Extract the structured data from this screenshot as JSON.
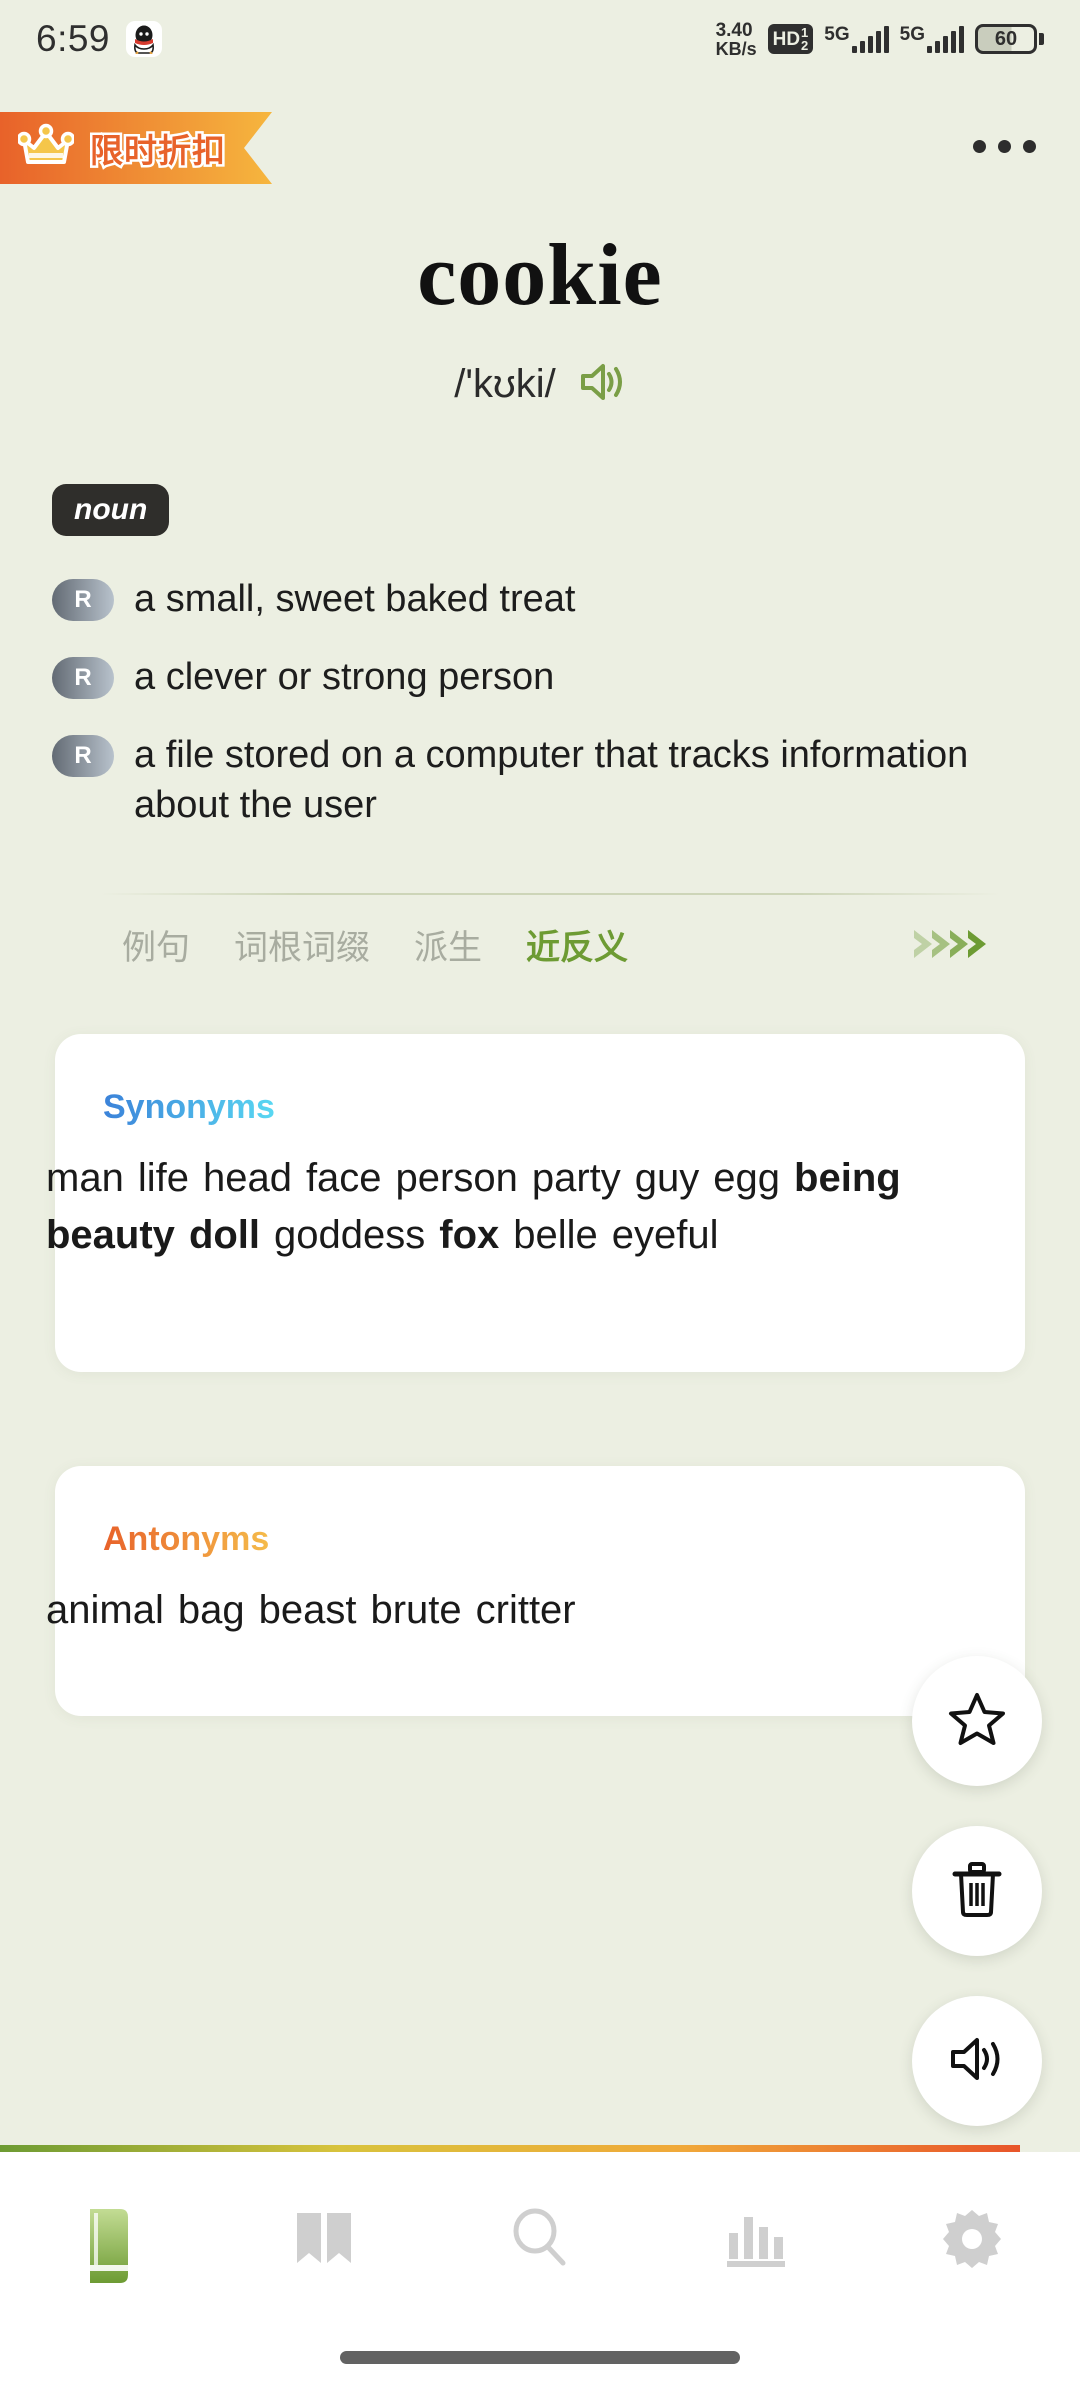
{
  "status_bar": {
    "clock": "6:59",
    "qq_icon": "qq-penguin-icon",
    "net_speed_value": "3.40",
    "net_speed_unit": "KB/s",
    "hd_label": "HD",
    "hd_sim_top": "1",
    "hd_sim_bottom": "2",
    "sim1_network": "5G",
    "sim2_network": "5G",
    "battery_level": "60"
  },
  "promo": {
    "label": "限时折扣",
    "crown_icon": "crown-icon",
    "gradient_start": "#e8622a",
    "gradient_end": "#f6b63e"
  },
  "overflow_menu_icon": "more-horizontal-icon",
  "word": {
    "headword": "cookie",
    "phonetic": "/'kʊki/",
    "speaker_icon": "speaker-icon",
    "speaker_color": "#7a9e46",
    "part_of_speech": "noun",
    "definitions": [
      {
        "badge": "R",
        "text": "a small, sweet baked treat"
      },
      {
        "badge": "R",
        "text": "a clever or strong person"
      },
      {
        "badge": "R",
        "text": "a file stored on a computer that tracks information about the user"
      }
    ]
  },
  "tabs": {
    "items": [
      {
        "label": "例句",
        "active": false
      },
      {
        "label": "词根词缀",
        "active": false
      },
      {
        "label": "派生",
        "active": false
      },
      {
        "label": "近反义",
        "active": true
      }
    ],
    "more_icon": "double-chevron-right-icon",
    "active_color": "#6d9b33",
    "inactive_color": "#a8aca0"
  },
  "synonyms": {
    "title": "Synonyms",
    "title_gradient_start": "#3b82d9",
    "title_gradient_end": "#59d8f2",
    "words": [
      {
        "text": "man",
        "emphasis": false
      },
      {
        "text": "life",
        "emphasis": false
      },
      {
        "text": "head",
        "emphasis": false
      },
      {
        "text": "face",
        "emphasis": false
      },
      {
        "text": "person",
        "emphasis": false
      },
      {
        "text": "party",
        "emphasis": false
      },
      {
        "text": "guy",
        "emphasis": false
      },
      {
        "text": "egg",
        "emphasis": false
      },
      {
        "text": "being",
        "emphasis": true
      },
      {
        "text": "beauty",
        "emphasis": true
      },
      {
        "text": "doll",
        "emphasis": true
      },
      {
        "text": "goddess",
        "emphasis": false
      },
      {
        "text": "fox",
        "emphasis": true
      },
      {
        "text": "belle",
        "emphasis": false
      },
      {
        "text": "eyeful",
        "emphasis": false
      }
    ]
  },
  "antonyms": {
    "title": "Antonyms",
    "title_gradient_start": "#e8622a",
    "title_gradient_end": "#f5bb4a",
    "words": [
      {
        "text": "animal",
        "emphasis": false
      },
      {
        "text": "bag",
        "emphasis": false
      },
      {
        "text": "beast",
        "emphasis": false
      },
      {
        "text": "brute",
        "emphasis": false
      },
      {
        "text": "critter",
        "emphasis": false
      }
    ]
  },
  "floating_actions": [
    {
      "name": "favorite",
      "icon": "star-icon"
    },
    {
      "name": "delete",
      "icon": "trash-icon"
    },
    {
      "name": "pronounce",
      "icon": "speaker-icon"
    }
  ],
  "bottom_nav": {
    "items": [
      {
        "icon": "book-closed-icon",
        "active": true
      },
      {
        "icon": "book-open-icon",
        "active": false
      },
      {
        "icon": "search-icon",
        "active": false
      },
      {
        "icon": "bar-chart-icon",
        "active": false
      },
      {
        "icon": "gear-icon",
        "active": false
      }
    ],
    "active_color": "#6d9b33",
    "inactive_color": "#cfcfcf"
  },
  "theme": {
    "page_background": "#ecefe2",
    "card_background": "#ffffff"
  }
}
